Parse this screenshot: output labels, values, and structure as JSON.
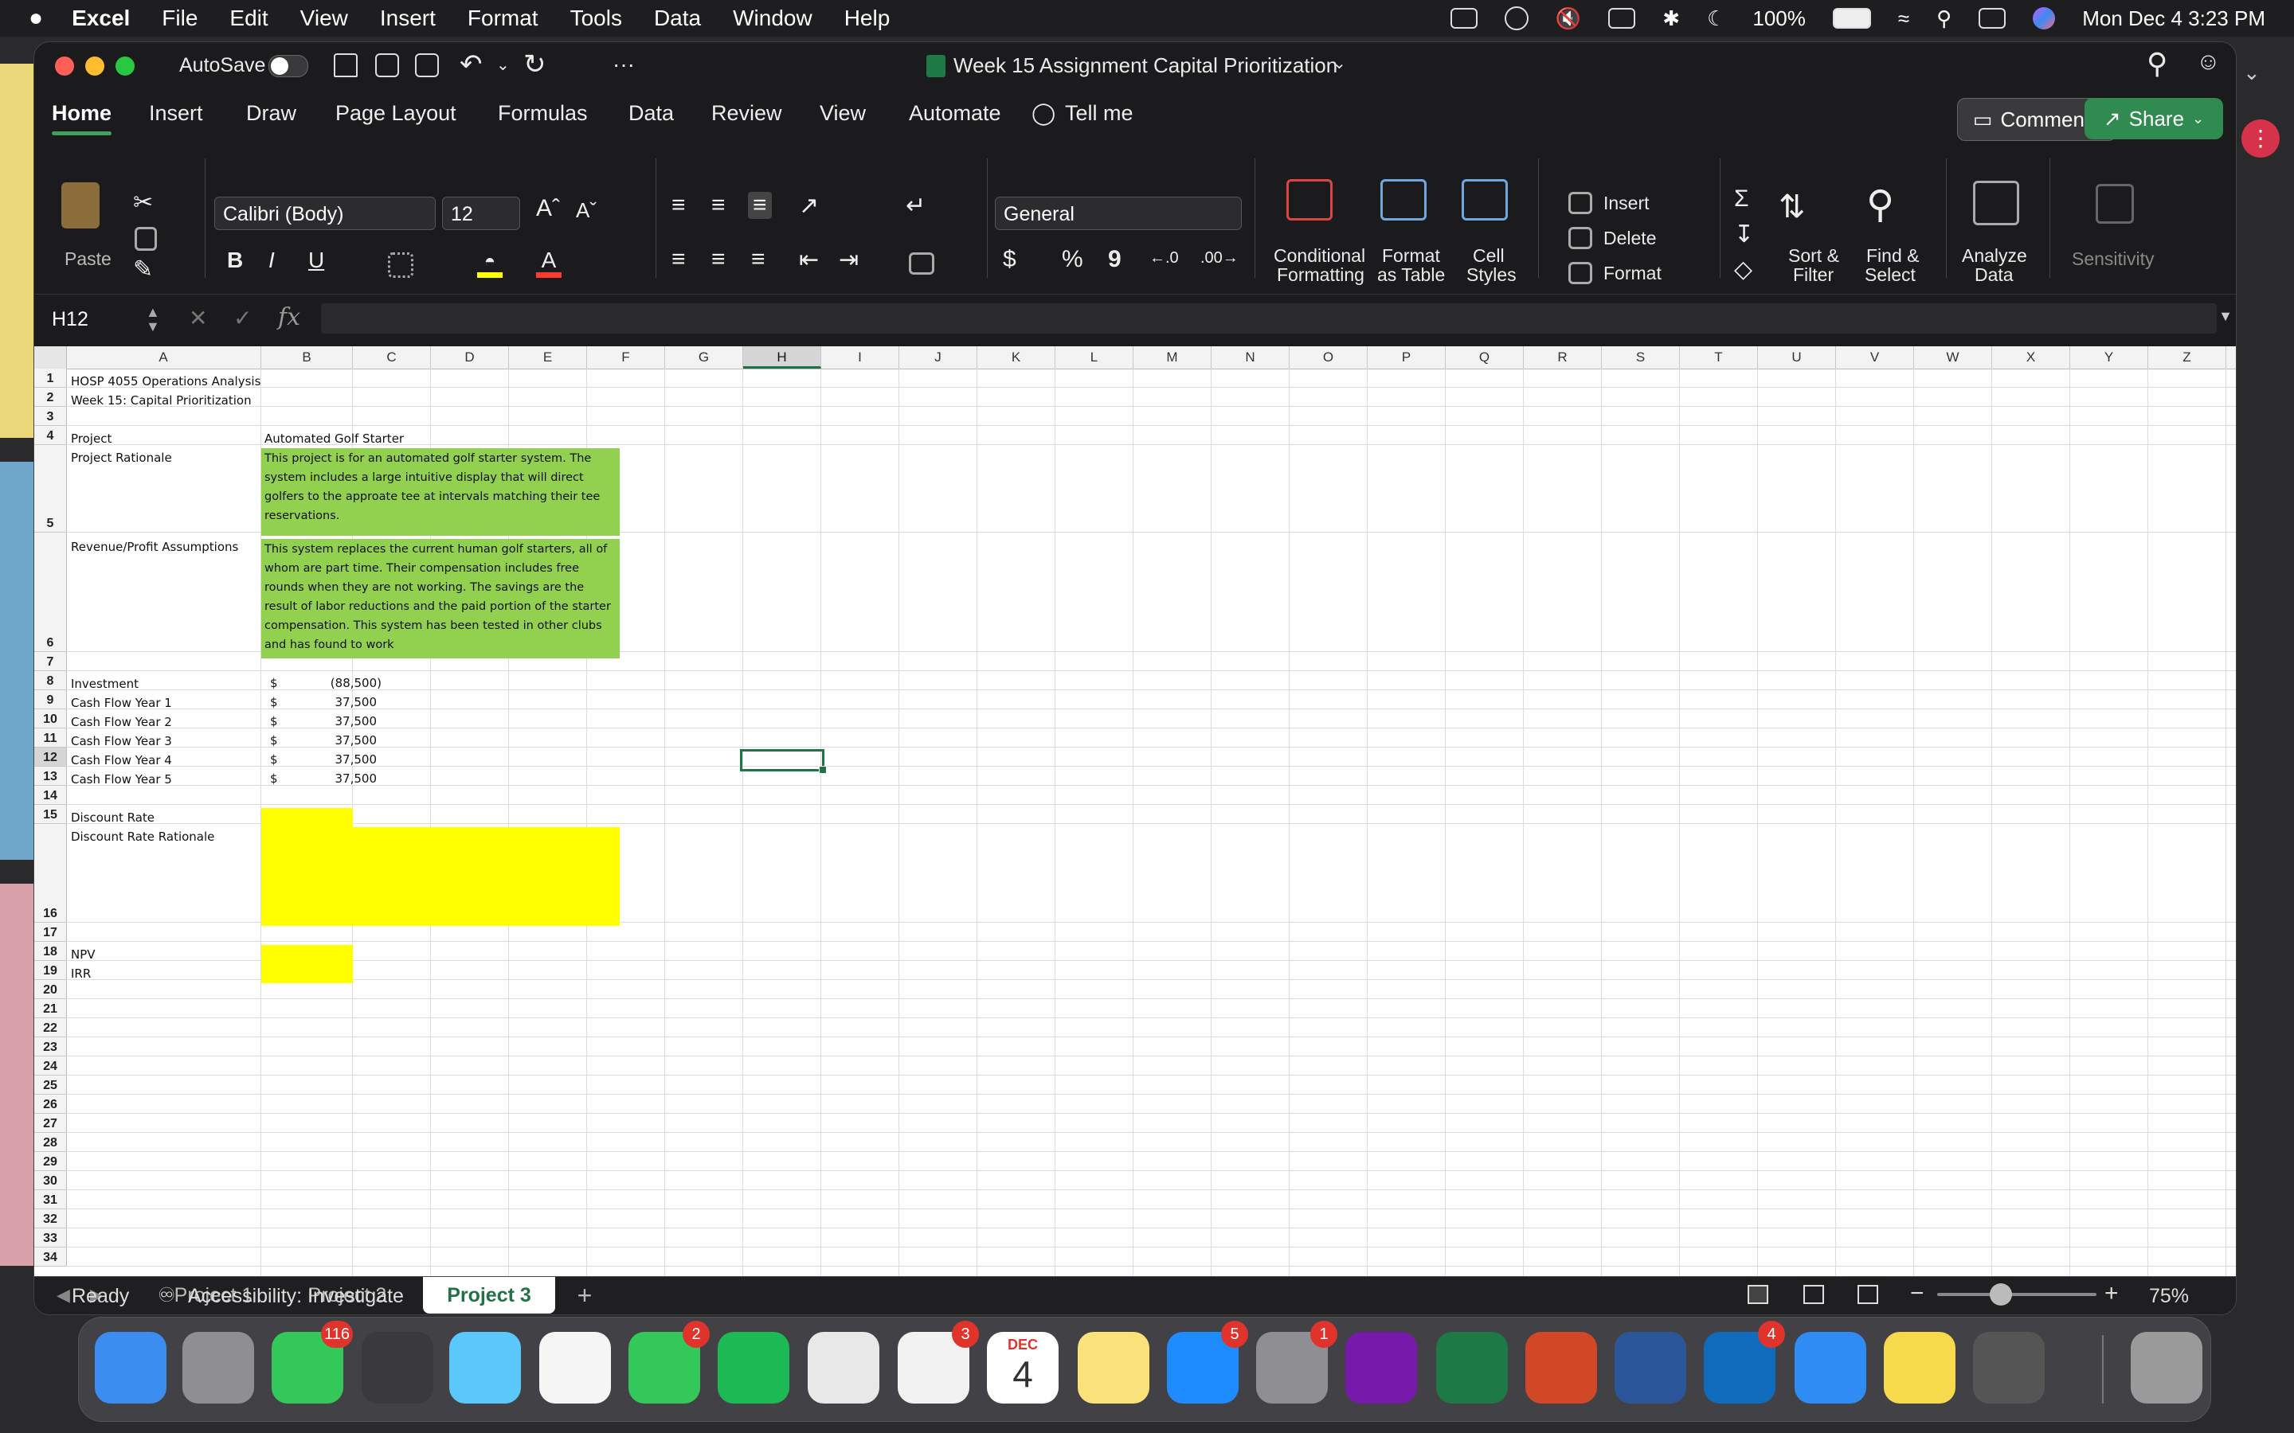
{
  "menubar": {
    "apple": "",
    "app": "Excel",
    "items": [
      "File",
      "Edit",
      "View",
      "Insert",
      "Format",
      "Tools",
      "Data",
      "Window",
      "Help"
    ],
    "battery": "100%",
    "datetime": "Mon Dec 4  3:23 PM"
  },
  "window": {
    "autosave": "AutoSave",
    "more": "···",
    "title": "Week 15 Assignment Capital Prioritization"
  },
  "ribbon_tabs": [
    "Home",
    "Insert",
    "Draw",
    "Page Layout",
    "Formulas",
    "Data",
    "Review",
    "View",
    "Automate"
  ],
  "tell_me": "Tell me",
  "comments_label": "Comments",
  "share_label": "Share",
  "ribbon": {
    "paste": "Paste",
    "font_name": "Calibri (Body)",
    "font_size": "12",
    "number_format": "General",
    "bold": "B",
    "italic": "I",
    "underline": "U",
    "currency": "$",
    "percent": "%",
    "comma": "9",
    "cond_fmt": [
      "Conditional",
      "Formatting"
    ],
    "fmt_table": [
      "Format",
      "as Table"
    ],
    "cell_styles": [
      "Cell",
      "Styles"
    ],
    "insert": "Insert",
    "delete": "Delete",
    "format": "Format",
    "sort_filter": [
      "Sort &",
      "Filter"
    ],
    "find_select": [
      "Find &",
      "Select"
    ],
    "analyze": [
      "Analyze",
      "Data"
    ],
    "sensitivity": "Sensitivity"
  },
  "formula_bar": {
    "name_box": "H12",
    "fx": "fx",
    "value": ""
  },
  "columns": [
    "A",
    "B",
    "C",
    "D",
    "E",
    "F",
    "G",
    "H",
    "I",
    "J",
    "K",
    "L",
    "M",
    "N",
    "O",
    "P",
    "Q",
    "R",
    "S",
    "T",
    "U",
    "V",
    "W",
    "X",
    "Y",
    "Z"
  ],
  "rows": [
    "1",
    "2",
    "3",
    "4",
    "5",
    "6",
    "7",
    "8",
    "9",
    "10",
    "11",
    "12",
    "13",
    "14",
    "15",
    "16",
    "17",
    "18",
    "19",
    "20",
    "21",
    "22",
    "23",
    "24",
    "25",
    "26",
    "27",
    "28",
    "29",
    "30",
    "31",
    "32",
    "33",
    "34"
  ],
  "selected": {
    "col": "H",
    "row": "12"
  },
  "cells": {
    "A1": "HOSP 4055 Operations Analysis",
    "A2": "Week 15: Capital Prioritization",
    "A4": "Project",
    "B4": "Automated Golf Starter",
    "A5": "Project Rationale",
    "B5": "This project is for an automated golf starter system.  The system includes a large intuitive display that will direct golfers to the approate tee at intervals matching their tee reservations.",
    "A6": "Revenue/Profit Assumptions",
    "B6": "This system replaces the current human golf starters, all of whom are part time.  Their compensation includes free rounds when they are not working.  The savings are the result of labor reductions and the paid portion of the starter compensation.  This system has been tested in other clubs and has found to work",
    "A8": "Investment",
    "A9": "Cash Flow Year 1",
    "A10": "Cash Flow Year 2",
    "A11": "Cash Flow Year 3",
    "A12": "Cash Flow Year 4",
    "A13": "Cash Flow Year 5",
    "A15": "Discount Rate",
    "A16": "Discount Rate Rationale",
    "A18": "NPV",
    "A19": "IRR"
  },
  "cash_flows": [
    {
      "symbol": "$",
      "value": "(88,500)"
    },
    {
      "symbol": "$",
      "value": "37,500"
    },
    {
      "symbol": "$",
      "value": "37,500"
    },
    {
      "symbol": "$",
      "value": "37,500"
    },
    {
      "symbol": "$",
      "value": "37,500"
    },
    {
      "symbol": "$",
      "value": "37,500"
    }
  ],
  "fill_colors": {
    "green": "#92d050",
    "yellow": "#ffff00",
    "accent": "#217346"
  },
  "sheets": [
    "Project 1",
    "Project 2",
    "Project 3"
  ],
  "active_sheet": "Project 3",
  "add_sheet": "+",
  "status": {
    "ready": "Ready",
    "accessibility": "Accessibility: Investigate",
    "zoom": "75%"
  },
  "dock": [
    {
      "name": "finder-icon",
      "color": "#3b8ef0"
    },
    {
      "name": "launchpad-icon",
      "color": "#8e8e93"
    },
    {
      "name": "messages-icon",
      "color": "#34c759",
      "badge": "116"
    },
    {
      "name": "terminal-icon",
      "color": "#3a3a3c"
    },
    {
      "name": "maps-icon",
      "color": "#5ac8fa"
    },
    {
      "name": "photos-icon",
      "color": "#f5f5f5"
    },
    {
      "name": "facetime-icon",
      "color": "#34c759",
      "badge": "2"
    },
    {
      "name": "spotify-icon",
      "color": "#1db954"
    },
    {
      "name": "chrome-icon",
      "color": "#e8e8e8"
    },
    {
      "name": "reminders-icon",
      "color": "#f2f2f2",
      "badge": "3"
    },
    {
      "name": "calendar-icon",
      "color": "#ffffff",
      "month": "DEC",
      "day": "4"
    },
    {
      "name": "notes-icon",
      "color": "#fbe17a"
    },
    {
      "name": "app-store-icon",
      "color": "#1e8cff",
      "badge": "5"
    },
    {
      "name": "system-settings-icon",
      "color": "#8e8e93",
      "badge": "1"
    },
    {
      "name": "onenote-icon",
      "color": "#7719aa"
    },
    {
      "name": "excel-icon",
      "color": "#1d7a45"
    },
    {
      "name": "powerpoint-icon",
      "color": "#d24726"
    },
    {
      "name": "word-icon",
      "color": "#2b579a"
    },
    {
      "name": "outlook-icon",
      "color": "#0f6cbd",
      "badge": "4"
    },
    {
      "name": "safari-icon",
      "color": "#2f8cf4"
    },
    {
      "name": "stickies-icon",
      "color": "#f7d94c"
    },
    {
      "name": "calculator-icon",
      "color": "#555555"
    },
    {
      "name": "trash-icon",
      "color": "#9a9a9a"
    }
  ]
}
